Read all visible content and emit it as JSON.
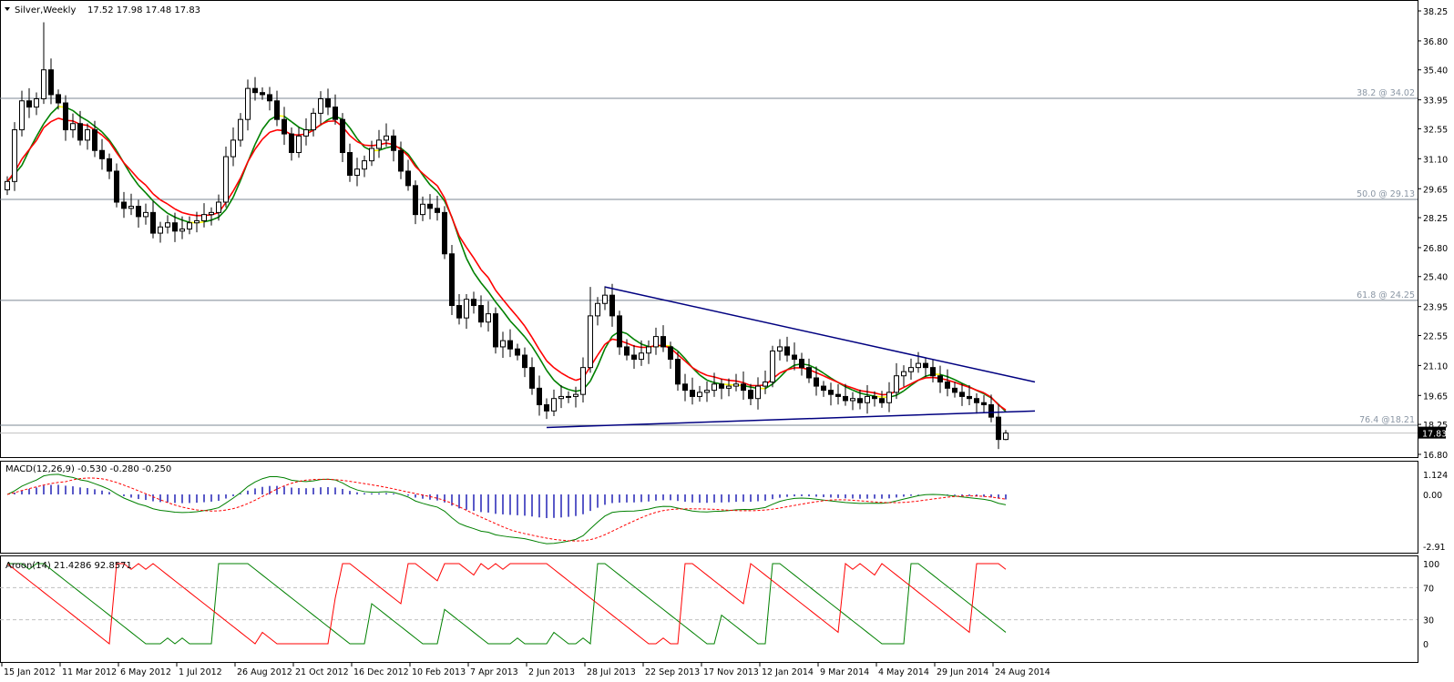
{
  "header": {
    "symbol_label": "Silver,Weekly",
    "ohlc": "17.52 17.98 17.48 17.83"
  },
  "chart_data": {
    "type": "candlestick",
    "title": "Silver,Weekly",
    "timeframe": "Weekly",
    "last_ohlc": {
      "open": 17.52,
      "high": 17.98,
      "low": 17.48,
      "close": 17.83
    },
    "current_price_label": "17.83",
    "closes": [
      30.0,
      32.5,
      33.9,
      33.6,
      34.0,
      35.4,
      34.2,
      33.8,
      32.5,
      32.8,
      32.0,
      32.5,
      31.5,
      31.1,
      30.5,
      29.0,
      28.7,
      28.8,
      28.3,
      28.5,
      27.5,
      27.8,
      28.0,
      27.6,
      27.7,
      28.0,
      28.1,
      28.4,
      28.5,
      29.0,
      31.2,
      32.0,
      33.0,
      34.5,
      34.3,
      34.2,
      33.9,
      33.0,
      32.3,
      31.4,
      32.2,
      32.5,
      33.3,
      34.0,
      33.6,
      33.0,
      31.4,
      30.3,
      30.6,
      31.0,
      31.6,
      32.0,
      32.2,
      31.5,
      30.5,
      29.8,
      28.4,
      28.9,
      28.7,
      28.5,
      26.5,
      24.0,
      23.4,
      24.3,
      24.0,
      23.2,
      23.6,
      22.0,
      22.3,
      21.9,
      21.6,
      21.0,
      20.0,
      19.2,
      18.9,
      19.5,
      19.6,
      19.6,
      19.7,
      21.0,
      23.5,
      24.1,
      24.5,
      23.5,
      22.0,
      21.6,
      21.4,
      21.7,
      22.0,
      22.5,
      22.0,
      21.4,
      20.2,
      19.9,
      19.6,
      19.8,
      19.9,
      20.2,
      20.0,
      20.1,
      20.2,
      19.9,
      19.5,
      20.1,
      20.3,
      21.8,
      22.0,
      21.6,
      21.4,
      21.0,
      20.5,
      20.1,
      19.9,
      19.7,
      19.6,
      19.4,
      19.5,
      19.3,
      19.6,
      19.5,
      19.3,
      19.8,
      20.6,
      20.8,
      21.0,
      21.2,
      21.0,
      20.6,
      20.3,
      20.0,
      19.8,
      19.6,
      19.5,
      19.3,
      19.2,
      18.6,
      17.52,
      17.83
    ],
    "price_axis": {
      "ticks": [
        "38.25",
        "36.80",
        "35.40",
        "33.95",
        "32.55",
        "31.10",
        "29.65",
        "28.25",
        "26.80",
        "25.40",
        "23.95",
        "22.55",
        "21.10",
        "19.65",
        "18.25",
        "16.80"
      ],
      "range": [
        16.8,
        38.25
      ]
    },
    "time_axis": {
      "ticks": [
        "15 Jan 2012",
        "11 Mar 2012",
        "6 May 2012",
        "1 Jul 2012",
        "26 Aug 2012",
        "21 Oct 2012",
        "16 Dec 2012",
        "10 Feb 2013",
        "7 Apr 2013",
        "2 Jun 2013",
        "28 Jul 2013",
        "22 Sep 2013",
        "17 Nov 2013",
        "12 Jan 2014",
        "9 Mar 2014",
        "4 May 2014",
        "29 Jun 2014",
        "24 Aug 2014"
      ]
    },
    "fibonacci": [
      {
        "label": "38.2 @ 34.02",
        "price": 34.02
      },
      {
        "label": "50.0 @ 29.13",
        "price": 29.13
      },
      {
        "label": "61.8 @ 24.25",
        "price": 24.25
      },
      {
        "label": "76.4 @18.21",
        "price": 18.21
      }
    ],
    "trendlines": [
      {
        "name": "descending-resistance",
        "from": [
          82,
          24.9
        ],
        "to": [
          141,
          20.3
        ]
      },
      {
        "name": "support",
        "from": [
          74,
          18.1
        ],
        "to": [
          141,
          18.9
        ]
      }
    ],
    "macd": {
      "label": "MACD(12,26,9) -0.530 -0.280 -0.250",
      "ticks": [
        "1.124",
        "0.00",
        "-2.91"
      ],
      "range": [
        -2.91,
        1.124
      ]
    },
    "aroon": {
      "label": "Aroon(14) 21.4286 92.8571",
      "ticks": [
        "100",
        "70",
        "30",
        "0"
      ],
      "period": 14
    },
    "colors": {
      "bull_body": "#ffffff",
      "bear_body": "#000000",
      "fast_ma": "#008000",
      "slow_ma": "#ff0000",
      "flat_ma": "#ffff00",
      "trendline": "#000080",
      "macd_hist": "#0000aa",
      "aroon_up": "#008000",
      "aroon_down": "#ff0000",
      "fib": "#7d8894"
    }
  }
}
